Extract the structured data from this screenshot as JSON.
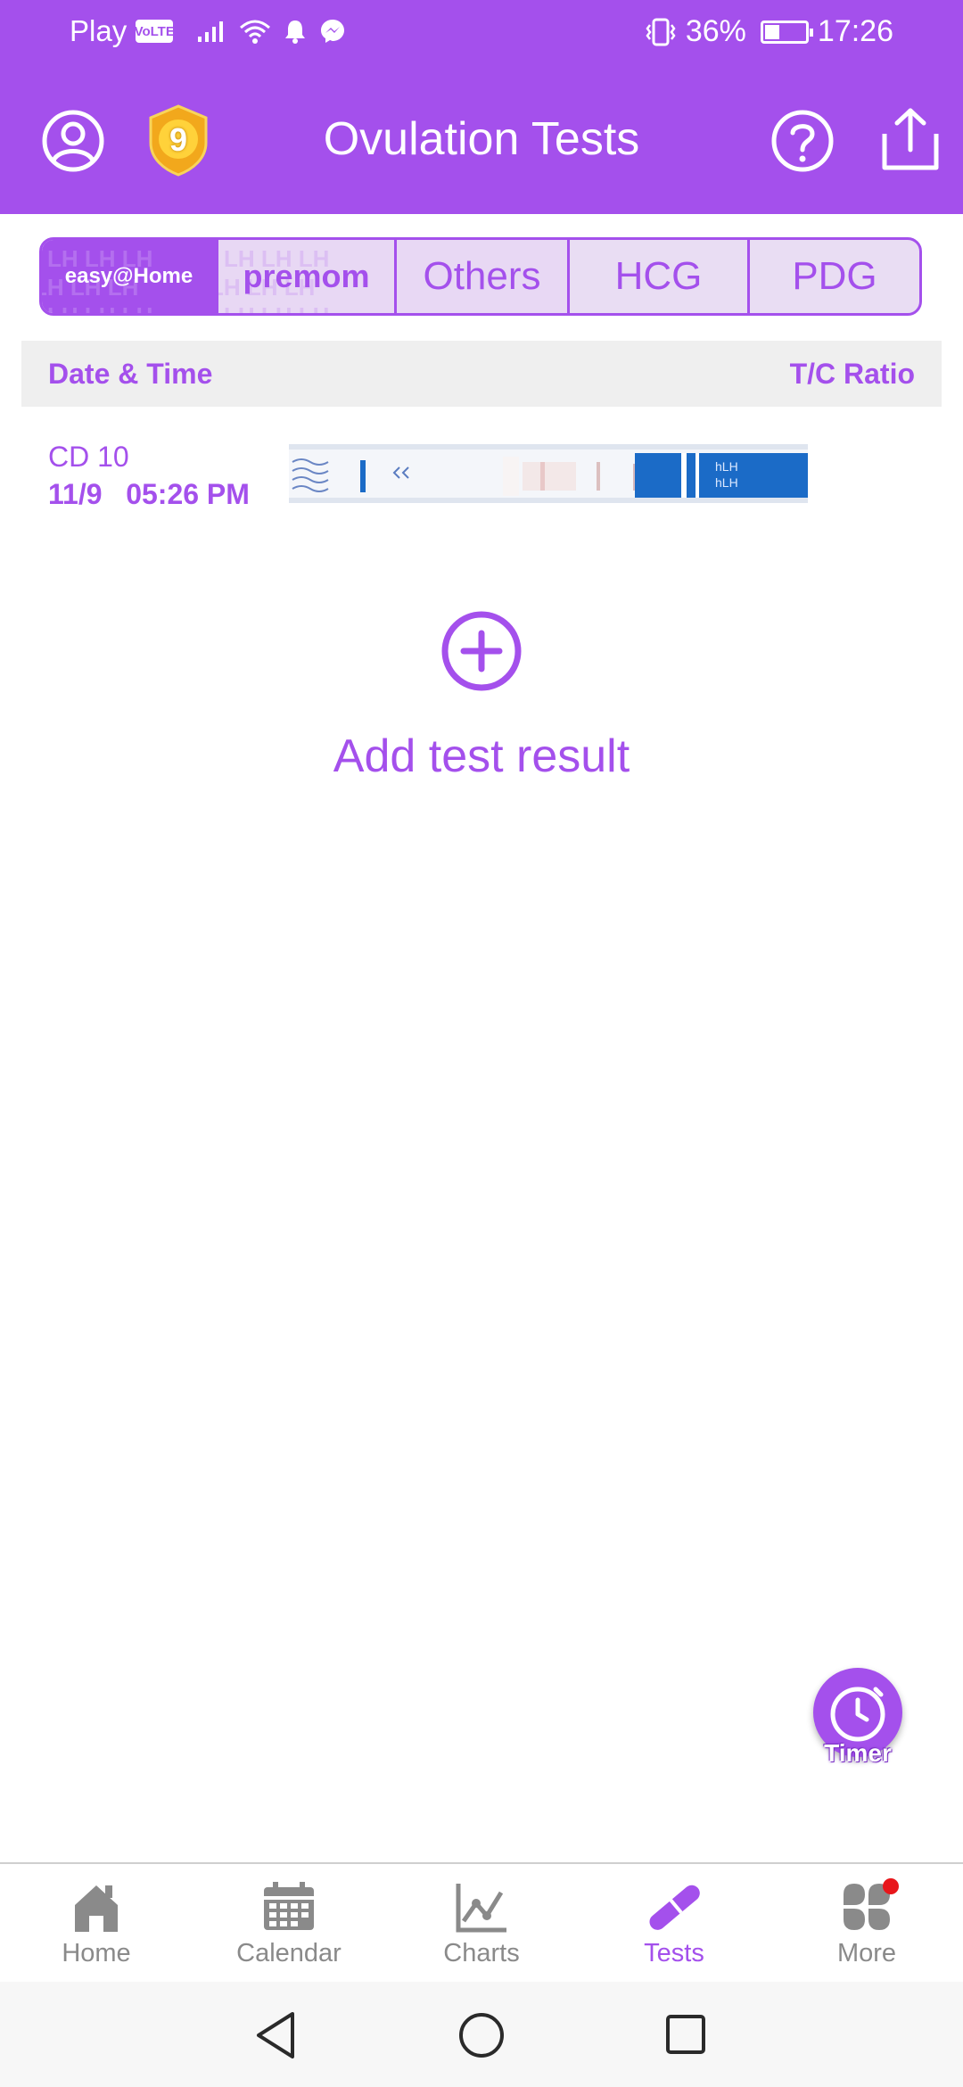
{
  "status_bar": {
    "carrier": "Play",
    "volte": "VoLTE",
    "battery": "36%",
    "battery_level": 0.36,
    "time": "17:26"
  },
  "app_bar": {
    "title": "Ovulation Tests",
    "badge_count": "9",
    "icons": [
      "profile-icon",
      "level-badge-icon",
      "help-icon",
      "share-icon"
    ]
  },
  "tabs": {
    "easy_home": "easy@Home",
    "premom": "premom",
    "others": "Others",
    "hcg": "HCG",
    "pdg": "PDG"
  },
  "table": {
    "date_time_header": "Date & Time",
    "ratio_header": "T/C Ratio"
  },
  "test_row": {
    "cycle_day": "CD 10",
    "date_time": "11/9   05:26 PM",
    "strip_text_1": "hLH",
    "strip_text_2": "hLH"
  },
  "add_test": {
    "label": "Add test result"
  },
  "timer": {
    "label": "Timer"
  },
  "bottom_nav": {
    "home": "Home",
    "calendar": "Calendar",
    "charts": "Charts",
    "tests": "Tests",
    "more": "More",
    "active": "Tests"
  },
  "colors": {
    "brand_purple": "#a450ec",
    "inactive_gray": "#8a8a8a",
    "notification_red": "#e8161b",
    "strip_blue": "#1b6bc7"
  }
}
